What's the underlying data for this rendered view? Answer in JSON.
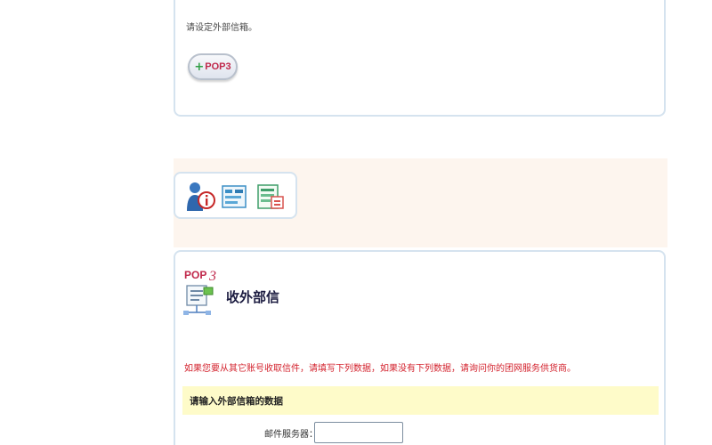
{
  "top_panel": {
    "hint": "请设定外部信箱。",
    "pop3_button": {
      "label": "POP3",
      "icon": "plus-icon"
    }
  },
  "toolbar": {
    "buttons": [
      {
        "name": "user-info-icon"
      },
      {
        "name": "mail-settings-icon"
      },
      {
        "name": "mail-list-icon"
      }
    ]
  },
  "pop3_panel": {
    "logo_text": "POP3",
    "title": "收外部信",
    "intro": "如果您要从其它账号收取信件，请填写下列数据，如果没有下列数据，请询问你的团网服务供货商。",
    "section_title": "请输入外部信箱的数据",
    "fields": {
      "server_label": "邮件服务器：",
      "server_value": "",
      "server_placeholder": ""
    }
  },
  "colors": {
    "panel_border": "#d5e3ef",
    "band_bg": "#fdf5ee",
    "intro_red": "#d3222d",
    "section_yellow": "#fefbc9",
    "pop3_red": "#c0284b"
  }
}
